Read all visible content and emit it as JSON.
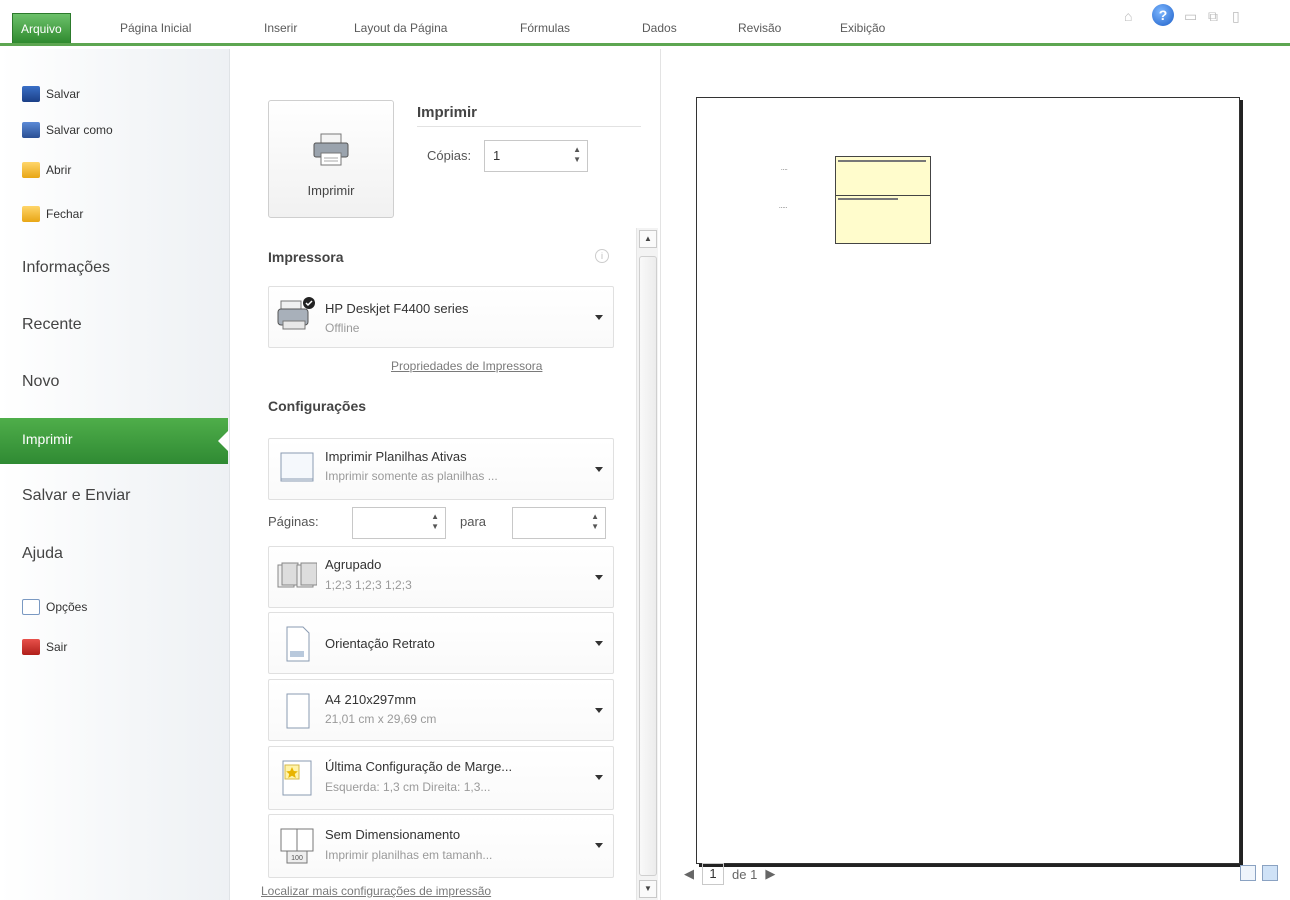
{
  "ribbon": {
    "tabs": [
      {
        "label": "Arquivo"
      },
      {
        "label": "Página Inicial"
      },
      {
        "label": "Inserir"
      },
      {
        "label": "Layout da Página"
      },
      {
        "label": "Fórmulas"
      },
      {
        "label": "Dados"
      },
      {
        "label": "Revisão"
      },
      {
        "label": "Exibição"
      }
    ]
  },
  "nav": {
    "top_items": [
      "Salvar",
      "Salvar como",
      "Abrir",
      "Fechar"
    ],
    "sections": [
      "Informações",
      "Recente",
      "Novo"
    ],
    "active": "Imprimir",
    "more_sections": [
      "Salvar e Enviar",
      "Ajuda"
    ],
    "bottom_items": [
      "Opções",
      "Sair"
    ]
  },
  "print": {
    "button_label": "Imprimir",
    "title": "Imprimir",
    "copies_label": "Cópias:",
    "copies_value": "1"
  },
  "printer": {
    "section_title": "Impressora",
    "name": "HP Deskjet F4400 series",
    "status": "Offline",
    "properties_link": "Propriedades de Impressora"
  },
  "settings": {
    "section_title": "Configurações",
    "what_title": "Imprimir Planilhas Ativas",
    "what_sub": "Imprimir somente as planilhas ...",
    "pages_label": "Páginas:",
    "pages_to": "para",
    "collate_title": "Agrupado",
    "collate_sub": "1;2;3   1;2;3   1;2;3",
    "orientation": "Orientação Retrato",
    "paper_title": "A4 210x297mm",
    "paper_sub": "21,01 cm x 29,69 cm",
    "margins_title": "Última Configuração de Marge...",
    "margins_sub": "Esquerda: 1,3 cm   Direita: 1,3...",
    "scaling_title": "Sem Dimensionamento",
    "scaling_sub": "Imprimir planilhas em tamanh...",
    "more_link": "Localizar mais configurações de impressão"
  },
  "preview": {
    "page_current": "1",
    "page_total_text": "de 1"
  },
  "colors": {
    "accent": "#2f8a33",
    "cell_fill": "#fffccc"
  }
}
